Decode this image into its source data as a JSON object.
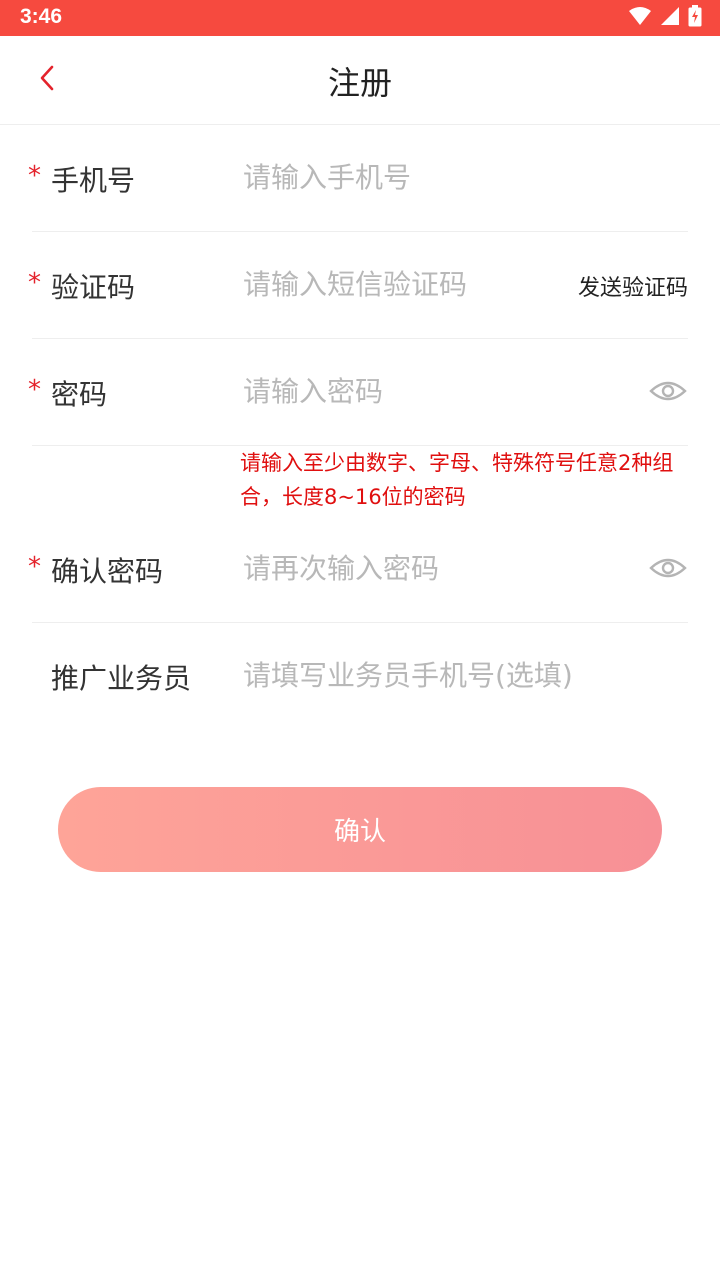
{
  "status_bar": {
    "time": "3:46",
    "color": "#f64a3f"
  },
  "header": {
    "title": "注册",
    "back_icon": "chevron-left-icon"
  },
  "form": {
    "phone": {
      "required_mark": "*",
      "label": "手机号",
      "placeholder": "请输入手机号"
    },
    "code": {
      "required_mark": "*",
      "label": "验证码",
      "placeholder": "请输入短信验证码",
      "send_label": "发送验证码"
    },
    "password": {
      "required_mark": "*",
      "label": "密码",
      "placeholder": "请输入密码",
      "hint": "请输入至少由数字、字母、特殊符号任意2种组合，长度8~16位的密码"
    },
    "confirm_password": {
      "required_mark": "*",
      "label": "确认密码",
      "placeholder": "请再次输入密码"
    },
    "salesperson": {
      "label": "推广业务员",
      "placeholder": "请填写业务员手机号(选填)"
    }
  },
  "confirm_button": {
    "label": "确认"
  },
  "colors": {
    "accent": "#e4232c",
    "hint": "#e00f0f",
    "button_start": "#fea498",
    "button_end": "#f79096"
  }
}
